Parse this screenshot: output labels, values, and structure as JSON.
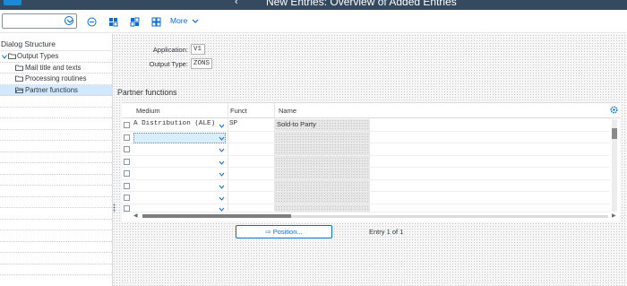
{
  "header": {
    "title": "New Entries: Overview of Added Entries"
  },
  "toolbar": {
    "combo_value": "",
    "more_label": "More"
  },
  "tree": {
    "header": "Dialog Structure",
    "items": [
      {
        "label": "Output Types"
      },
      {
        "label": "Mail title and texts"
      },
      {
        "label": "Processing routines"
      },
      {
        "label": "Partner functions"
      }
    ]
  },
  "fields": {
    "application_label": "Application:",
    "application_value": "V1",
    "output_type_label": "Output Type:",
    "output_type_value": "ZONS"
  },
  "section": {
    "title": "Partner functions"
  },
  "table": {
    "columns": [
      "Medium",
      "Funct",
      "Name"
    ],
    "rows": [
      {
        "medium": "A Distribution (ALE)",
        "funct": "SP",
        "name": "Sold-to Party"
      },
      {
        "medium": "",
        "funct": "",
        "name": ""
      },
      {
        "medium": "",
        "funct": "",
        "name": ""
      },
      {
        "medium": "",
        "funct": "",
        "name": ""
      },
      {
        "medium": "",
        "funct": "",
        "name": ""
      },
      {
        "medium": "",
        "funct": "",
        "name": ""
      },
      {
        "medium": "",
        "funct": "",
        "name": ""
      },
      {
        "medium": "",
        "funct": "",
        "name": ""
      }
    ]
  },
  "footer": {
    "position_label": "Position...",
    "entry_text": "Entry 1 of 1"
  },
  "colors": {
    "shell": "#354a5f",
    "accent": "#0a6ed1",
    "selection": "#d1e8ff"
  }
}
